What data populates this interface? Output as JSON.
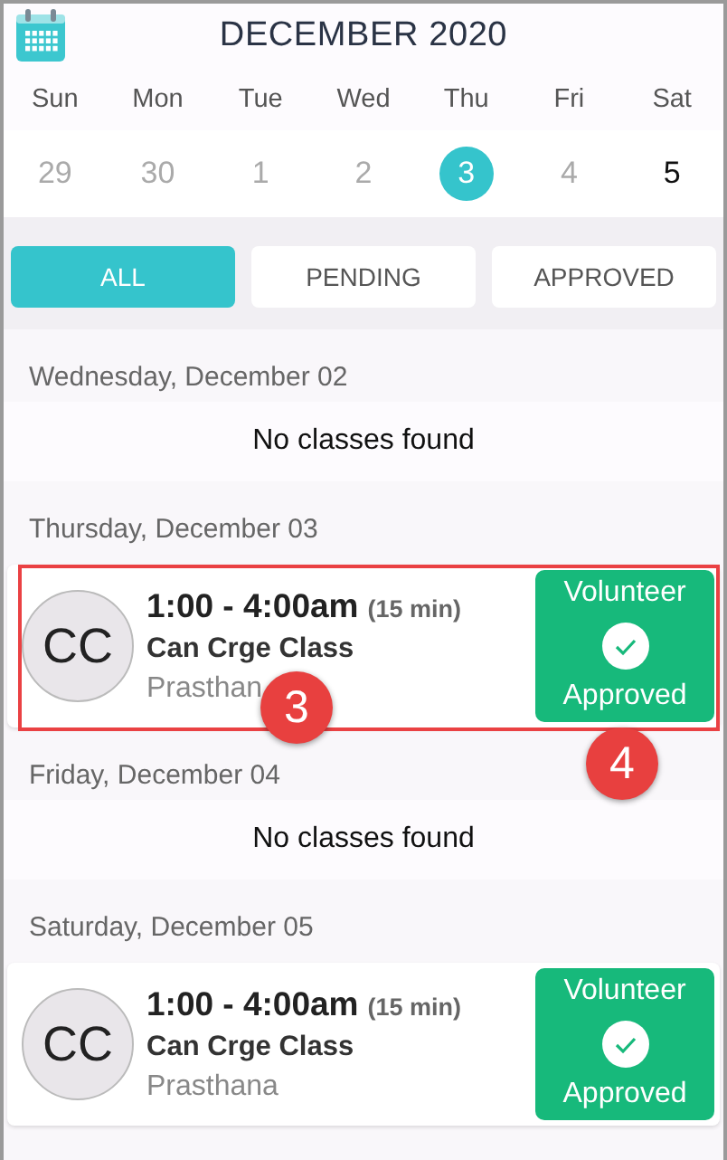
{
  "header": {
    "title": "DECEMBER 2020"
  },
  "weekdays": [
    "Sun",
    "Mon",
    "Tue",
    "Wed",
    "Thu",
    "Fri",
    "Sat"
  ],
  "dates": [
    {
      "label": "29",
      "muted": true,
      "selected": false
    },
    {
      "label": "30",
      "muted": true,
      "selected": false
    },
    {
      "label": "1",
      "muted": true,
      "selected": false
    },
    {
      "label": "2",
      "muted": true,
      "selected": false
    },
    {
      "label": "3",
      "muted": false,
      "selected": true
    },
    {
      "label": "4",
      "muted": true,
      "selected": false
    },
    {
      "label": "5",
      "muted": false,
      "selected": false
    }
  ],
  "filters": [
    {
      "label": "ALL",
      "selected": true
    },
    {
      "label": "PENDING",
      "selected": false
    },
    {
      "label": "APPROVED",
      "selected": false
    }
  ],
  "days": [
    {
      "heading": "Wednesday, December 02",
      "empty": "No classes found"
    },
    {
      "heading": "Thursday, December 03",
      "classes": [
        {
          "initials": "CC",
          "time": "1:00 - 4:00am",
          "duration": "(15 min)",
          "title": "Can Crge Class",
          "host": "Prasthan",
          "highlighted": true,
          "status": {
            "kind": "approved",
            "top": "Volunteer",
            "bottom": "Approved"
          },
          "callouts": [
            {
              "label": "3",
              "kind": "host"
            },
            {
              "label": "4",
              "kind": "status"
            }
          ]
        }
      ]
    },
    {
      "heading": "Friday, December 04",
      "empty": "No classes found"
    },
    {
      "heading": "Saturday, December 05",
      "classes": [
        {
          "initials": "CC",
          "time": "1:00 - 4:00am",
          "duration": "(15 min)",
          "title": "Can Crge Class",
          "host": "Prasthana",
          "highlighted": false,
          "status": {
            "kind": "approved",
            "top": "Volunteer",
            "bottom": "Approved"
          }
        }
      ]
    }
  ]
}
